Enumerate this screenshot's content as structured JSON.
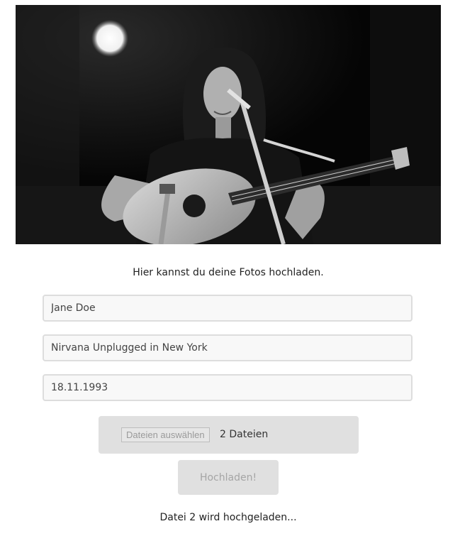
{
  "hero": {
    "description_icon": "concert-photo"
  },
  "form": {
    "intro_text": "Hier kannst du deine Fotos hochladen.",
    "name_value": "Jane Doe",
    "event_value": "Nirvana Unplugged in New York",
    "date_value": "18.11.1993",
    "file_button_label": "Dateien auswählen",
    "file_count_text": "2 Dateien",
    "upload_button_label": "Hochladen!",
    "status_text": "Datei 2 wird hochgeladen..."
  }
}
